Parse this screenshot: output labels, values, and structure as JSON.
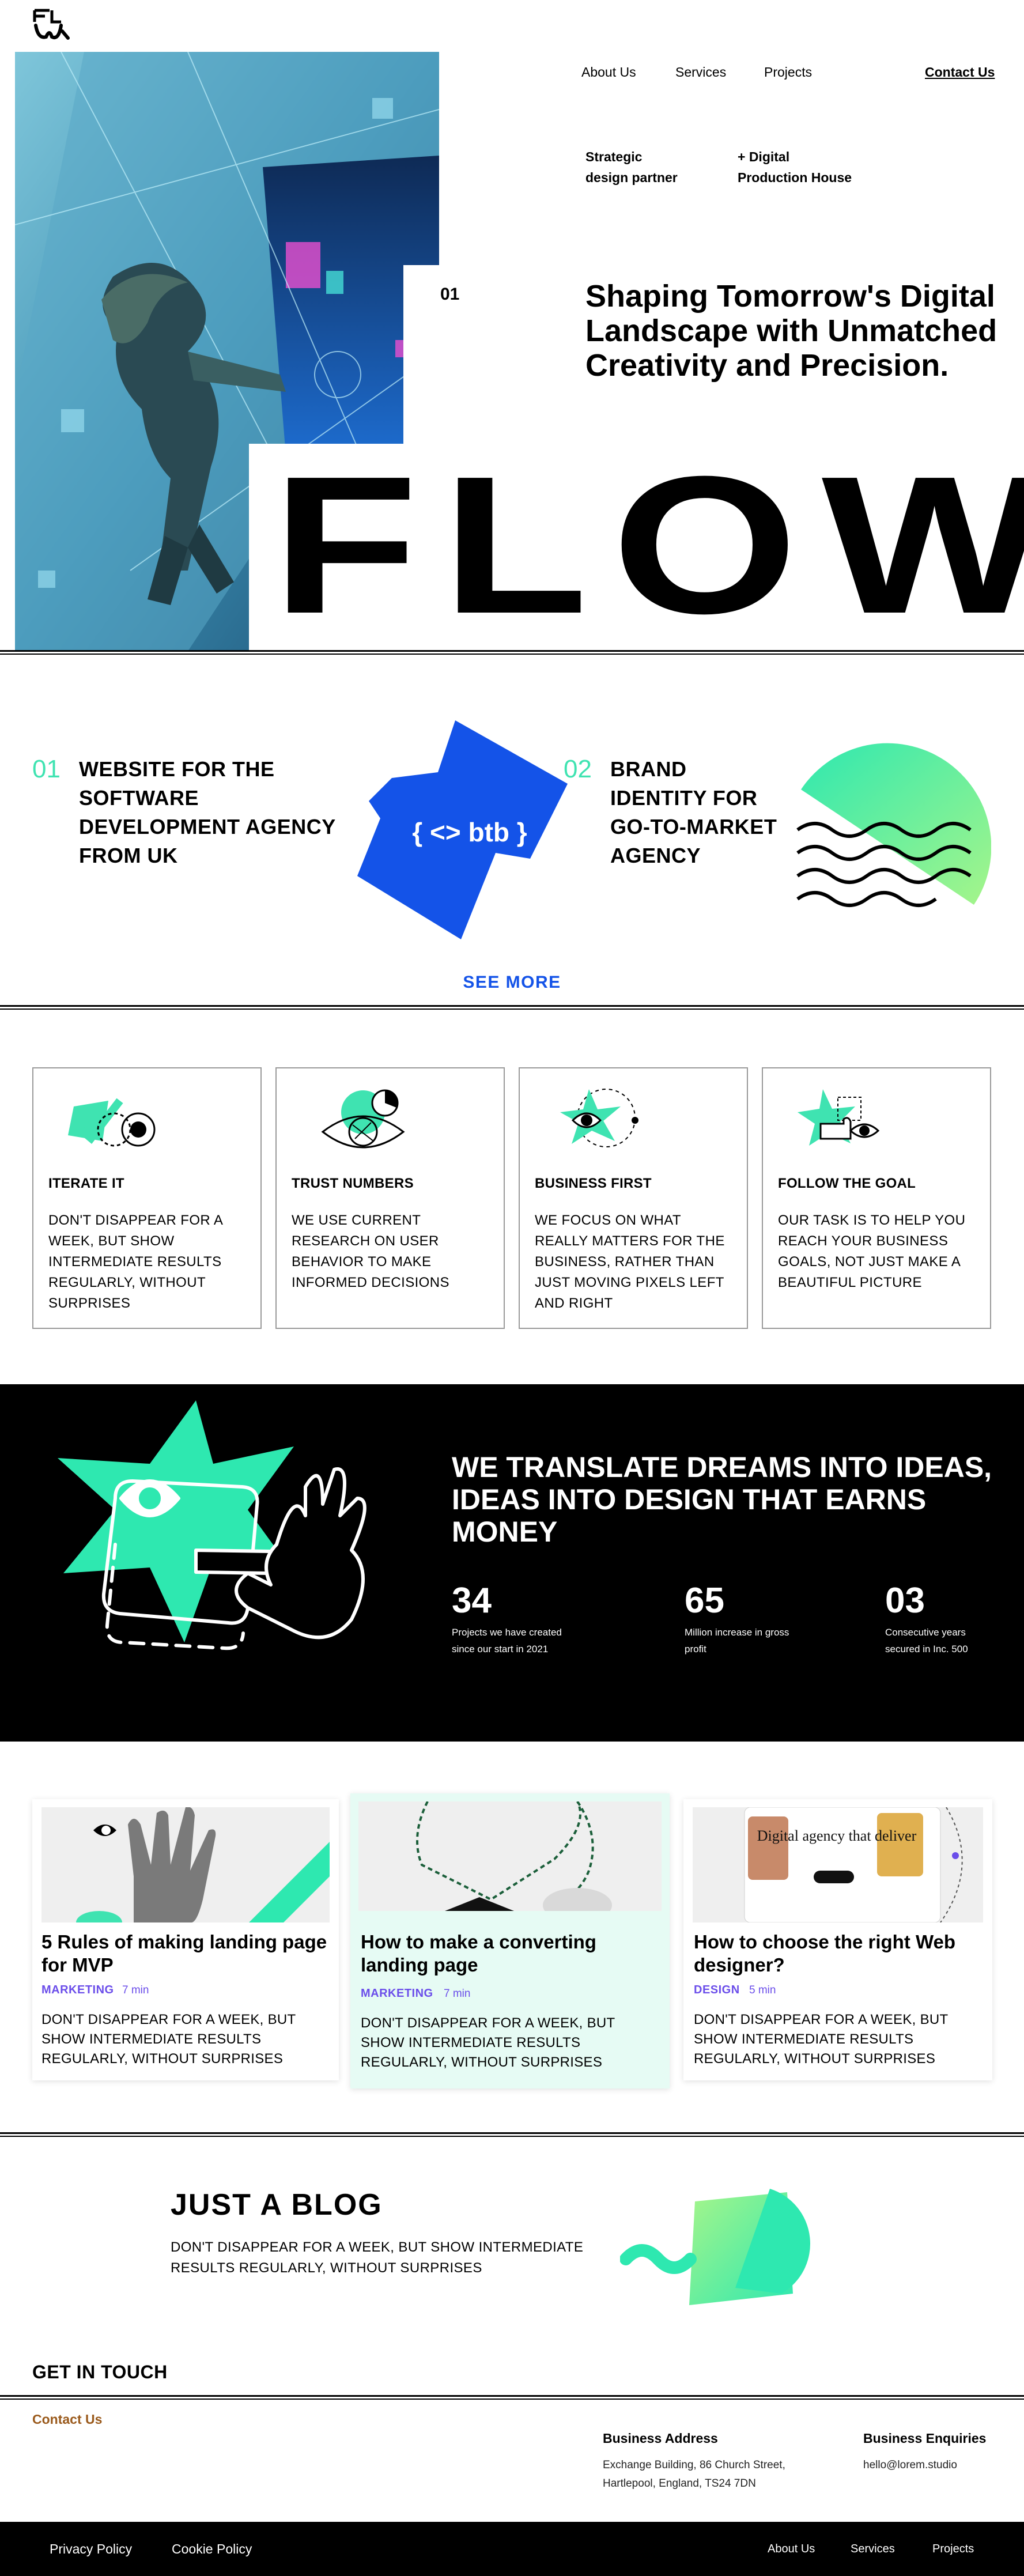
{
  "nav": {
    "about": "About Us",
    "services": "Services",
    "projects": "Projects",
    "contact": "Contact Us"
  },
  "hero": {
    "tagline_left": "Strategic\ndesign partner",
    "tagline_right": "+ Digital\nProduction House",
    "number": "01",
    "title": "Shaping Tomorrow's Digital Landscape with Unmatched Creativity and Precision.",
    "big_word": "FLOW"
  },
  "projects": {
    "items": [
      {
        "num": "01",
        "title": "WEBSITE FOR THE SOFTWARE DEVELOPMENT AGENCY FROM UK",
        "badge": "{ <> btb }"
      },
      {
        "num": "02",
        "title": "BRAND IDENTITY FOR GO-TO-MARKET AGENCY"
      }
    ],
    "see_more": "SEE MORE"
  },
  "features": [
    {
      "title": "ITERATE IT",
      "text": "DON'T DISAPPEAR FOR A WEEK, BUT SHOW INTERMEDIATE RESULTS REGULARLY, WITHOUT SURPRISES"
    },
    {
      "title": "TRUST NUMBERS",
      "text": "WE USE CURRENT RESEARCH ON USER BEHAVIOR TO MAKE INFORMED DECISIONS"
    },
    {
      "title": "BUSINESS FIRST",
      "text": "WE FOCUS ON WHAT REALLY MATTERS FOR THE BUSINESS, RATHER THAN JUST MOVING PIXELS LEFT AND RIGHT"
    },
    {
      "title": "FOLLOW THE GOAL",
      "text": "OUR TASK IS TO HELP YOU REACH YOUR BUSINESS GOALS, NOT JUST MAKE A BEAUTIFUL PICTURE"
    }
  ],
  "mission": {
    "title": "WE TRANSLATE DREAMS INTO IDEAS, IDEAS INTO DESIGN THAT EARNS MONEY",
    "stats": [
      {
        "value": "34",
        "label": "Projects we have created since our start in 2021"
      },
      {
        "value": "65",
        "label": "Million increase in gross profit"
      },
      {
        "value": "03",
        "label": "Consecutive years secured in Inc. 500"
      }
    ]
  },
  "posts": [
    {
      "title": "5 Rules of making landing page for MVP",
      "tag": "MARKETING",
      "read": "7 min",
      "text": "DON'T DISAPPEAR FOR A WEEK, BUT SHOW INTERMEDIATE RESULTS REGULARLY, WITHOUT SURPRISES"
    },
    {
      "title": "How to make a converting landing page",
      "tag": "MARKETING",
      "read": "7 min",
      "text": "DON'T DISAPPEAR FOR A WEEK, BUT SHOW INTERMEDIATE RESULTS REGULARLY, WITHOUT SURPRISES"
    },
    {
      "title": "How to choose the right Web designer?",
      "tag": "DESIGN",
      "read": "5 min",
      "text": "DON'T DISAPPEAR FOR A WEEK, BUT SHOW INTERMEDIATE RESULTS REGULARLY, WITHOUT SURPRISES",
      "image_caption": "Digital agency that deliver"
    }
  ],
  "blog": {
    "title": "JUST A BLOG",
    "subtitle": "DON'T DISAPPEAR FOR A WEEK, BUT SHOW INTERMEDIATE RESULTS REGULARLY, WITHOUT SURPRISES"
  },
  "contact": {
    "heading": "GET IN TOUCH",
    "link": "Contact Us",
    "address_title": "Business Address",
    "address_line1": "Exchange Building, 86 Church Street,",
    "address_line2": "Hartlepool, England, TS24 7DN",
    "enquiries_title": "Business Enquiries",
    "email": "hello@lorem.studio"
  },
  "footer": {
    "privacy": "Privacy Policy",
    "cookie": "Cookie Policy",
    "about": "About Us",
    "services": "Services",
    "projects": "Projects"
  },
  "colors": {
    "accent_mint": "#3fe3b1",
    "accent_blue": "#1453e8",
    "tag_purple": "#6b4eea",
    "dark_bg": "#000000"
  }
}
